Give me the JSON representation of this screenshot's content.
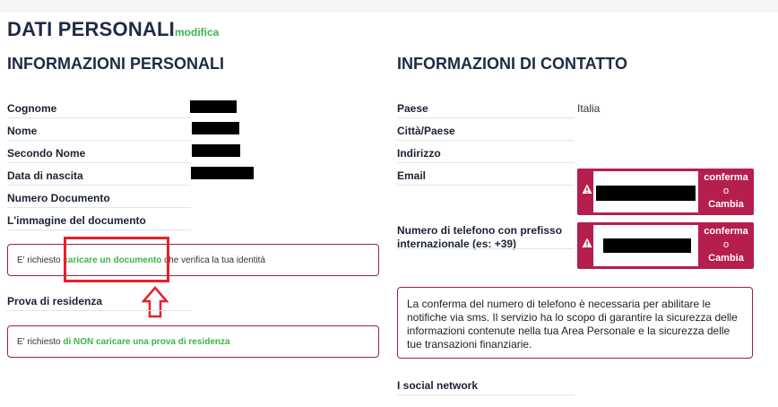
{
  "page": {
    "title": "DATI PERSONALI",
    "edit_label": "modifica"
  },
  "personal": {
    "heading": "INFORMAZIONI PERSONALI",
    "fields": {
      "surname": "Cognome",
      "name": "Nome",
      "middle_name": "Secondo Nome",
      "birth_date": "Data di nascita",
      "document_number": "Numero Documento",
      "document_image": "L'immagine del documento",
      "residence_proof": "Prova di residenza"
    },
    "doc_notice": {
      "prefix": "E' richiesto ",
      "link": "caricare un documento",
      "suffix": " che verifica la tua identità"
    },
    "residence_notice": {
      "prefix": "E' richiesto ",
      "link": "di NON caricare una prova di residenza"
    }
  },
  "contact": {
    "heading": "INFORMAZIONI DI CONTATTO",
    "fields": {
      "country": "Paese",
      "country_value": "Italia",
      "city": "Città/Paese",
      "address": "Indirizzo",
      "email": "Email",
      "phone": "Numero di telefono con prefisso internazionale (es: +39)",
      "social": "I social network"
    },
    "confirm_button": {
      "confirm": "conferma",
      "or": "o",
      "change": "Cambia"
    },
    "phone_info": "La conferma del numero di telefono è necessaria per abilitare le notifiche via sms. Il servizio ha lo scopo di garantire la sicurezza delle informazioni contenute nella tua Area Personale e la sicurezza delle tue transazioni finanziarie."
  },
  "colors": {
    "accent_green": "#3ab54a",
    "brand_crimson": "#b61e4e",
    "highlight_red": "#e8202a",
    "heading_navy": "#1f2a44"
  },
  "icons": [
    "warning-icon",
    "up-arrow-icon"
  ]
}
